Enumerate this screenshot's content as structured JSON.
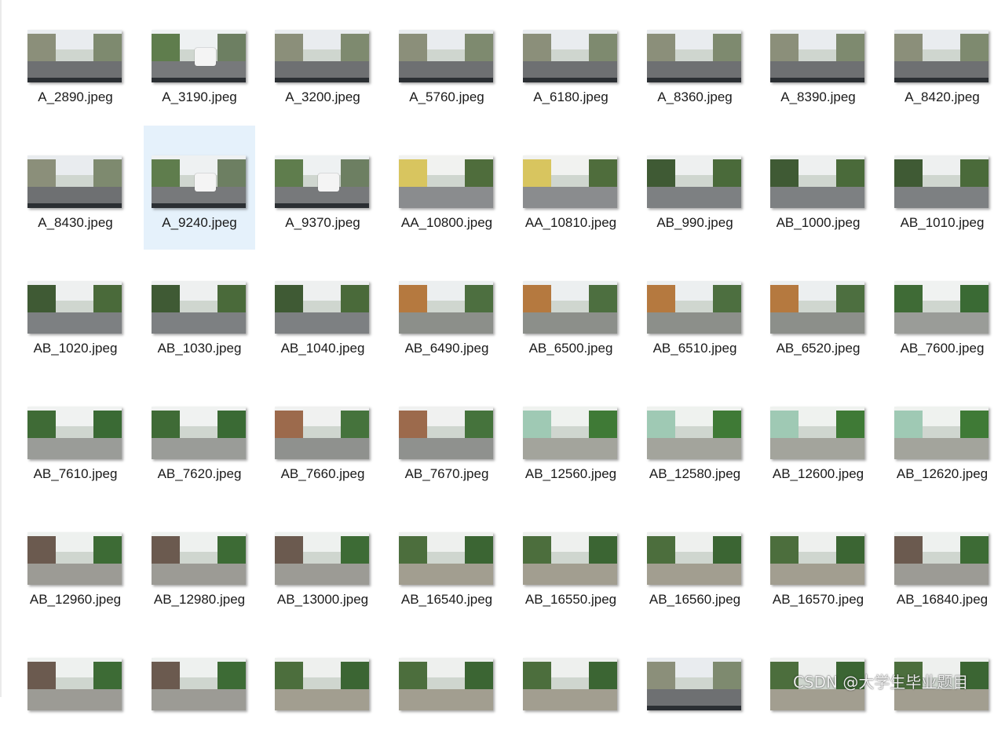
{
  "files": [
    {
      "name": "A_2890.jpeg",
      "scene": "city"
    },
    {
      "name": "A_3190.jpeg",
      "scene": "city-car"
    },
    {
      "name": "A_3200.jpeg",
      "scene": "city"
    },
    {
      "name": "A_5760.jpeg",
      "scene": "city"
    },
    {
      "name": "A_6180.jpeg",
      "scene": "city"
    },
    {
      "name": "A_8360.jpeg",
      "scene": "city"
    },
    {
      "name": "A_8390.jpeg",
      "scene": "city"
    },
    {
      "name": "A_8420.jpeg",
      "scene": "city"
    },
    {
      "name": "A_8430.jpeg",
      "scene": "city"
    },
    {
      "name": "A_9240.jpeg",
      "scene": "city-car",
      "selected": true
    },
    {
      "name": "A_9370.jpeg",
      "scene": "city-car"
    },
    {
      "name": "AA_10800.jpeg",
      "scene": "yellow"
    },
    {
      "name": "AA_10810.jpeg",
      "scene": "yellow"
    },
    {
      "name": "AB_990.jpeg",
      "scene": "trees-cars"
    },
    {
      "name": "AB_1000.jpeg",
      "scene": "trees-cars"
    },
    {
      "name": "AB_1010.jpeg",
      "scene": "trees-cars"
    },
    {
      "name": "AB_1020.jpeg",
      "scene": "trees-cars"
    },
    {
      "name": "AB_1030.jpeg",
      "scene": "trees-cars"
    },
    {
      "name": "AB_1040.jpeg",
      "scene": "trees-cars"
    },
    {
      "name": "AB_6490.jpeg",
      "scene": "residential"
    },
    {
      "name": "AB_6500.jpeg",
      "scene": "residential"
    },
    {
      "name": "AB_6510.jpeg",
      "scene": "residential"
    },
    {
      "name": "AB_6520.jpeg",
      "scene": "residential"
    },
    {
      "name": "AB_7600.jpeg",
      "scene": "green"
    },
    {
      "name": "AB_7610.jpeg",
      "scene": "green"
    },
    {
      "name": "AB_7620.jpeg",
      "scene": "green"
    },
    {
      "name": "AB_7660.jpeg",
      "scene": "brick"
    },
    {
      "name": "AB_7670.jpeg",
      "scene": "brick"
    },
    {
      "name": "AB_12560.jpeg",
      "scene": "pastel"
    },
    {
      "name": "AB_12580.jpeg",
      "scene": "pastel"
    },
    {
      "name": "AB_12600.jpeg",
      "scene": "pastel"
    },
    {
      "name": "AB_12620.jpeg",
      "scene": "pastel"
    },
    {
      "name": "AB_12960.jpeg",
      "scene": "residential-green"
    },
    {
      "name": "AB_12980.jpeg",
      "scene": "residential-green"
    },
    {
      "name": "AB_13000.jpeg",
      "scene": "residential-green"
    },
    {
      "name": "AB_16540.jpeg",
      "scene": "forest"
    },
    {
      "name": "AB_16550.jpeg",
      "scene": "forest"
    },
    {
      "name": "AB_16560.jpeg",
      "scene": "forest"
    },
    {
      "name": "AB_16570.jpeg",
      "scene": "forest"
    },
    {
      "name": "AB_16840.jpeg",
      "scene": "residential-green"
    },
    {
      "name": "",
      "scene": "residential-green"
    },
    {
      "name": "",
      "scene": "residential-green"
    },
    {
      "name": "",
      "scene": "forest"
    },
    {
      "name": "",
      "scene": "forest"
    },
    {
      "name": "",
      "scene": "forest"
    },
    {
      "name": "",
      "scene": "city"
    },
    {
      "name": "",
      "scene": "forest"
    },
    {
      "name": "",
      "scene": "forest"
    }
  ],
  "scene_colors": {
    "city": {
      "sky": "#e9ecef",
      "left": "#8b8f7a",
      "right": "#7e8a6f",
      "road": "#6e7072"
    },
    "city-car": {
      "sky": "#eef1f2",
      "left": "#5f7d4d",
      "right": "#6d7f62",
      "road": "#77797b"
    },
    "yellow": {
      "sky": "#f1f2f0",
      "left": "#d8c55f",
      "right": "#4f6d3c",
      "road": "#8a8c8e"
    },
    "trees-cars": {
      "sky": "#eef0f0",
      "left": "#3f5a34",
      "right": "#4a6a3a",
      "road": "#7d8082"
    },
    "residential": {
      "sky": "#eceff0",
      "left": "#b5793f",
      "right": "#4d6f40",
      "road": "#8c8f8a"
    },
    "green": {
      "sky": "#f0f2f1",
      "left": "#3f6b36",
      "right": "#3a6a34",
      "road": "#9a9c98"
    },
    "brick": {
      "sky": "#f0f1f0",
      "left": "#9c6a4c",
      "right": "#45733c",
      "road": "#8f918e"
    },
    "pastel": {
      "sky": "#eff2ef",
      "left": "#9fc9b4",
      "right": "#3f7a36",
      "road": "#a3a49c"
    },
    "residential-green": {
      "sky": "#eef1ef",
      "left": "#6b5a4f",
      "right": "#3d6b35",
      "road": "#9c9b95"
    },
    "forest": {
      "sky": "#eef0ee",
      "left": "#4c6e3d",
      "right": "#3b6533",
      "road": "#a29e90"
    }
  },
  "watermark": "CSDN @大学生毕业题目"
}
